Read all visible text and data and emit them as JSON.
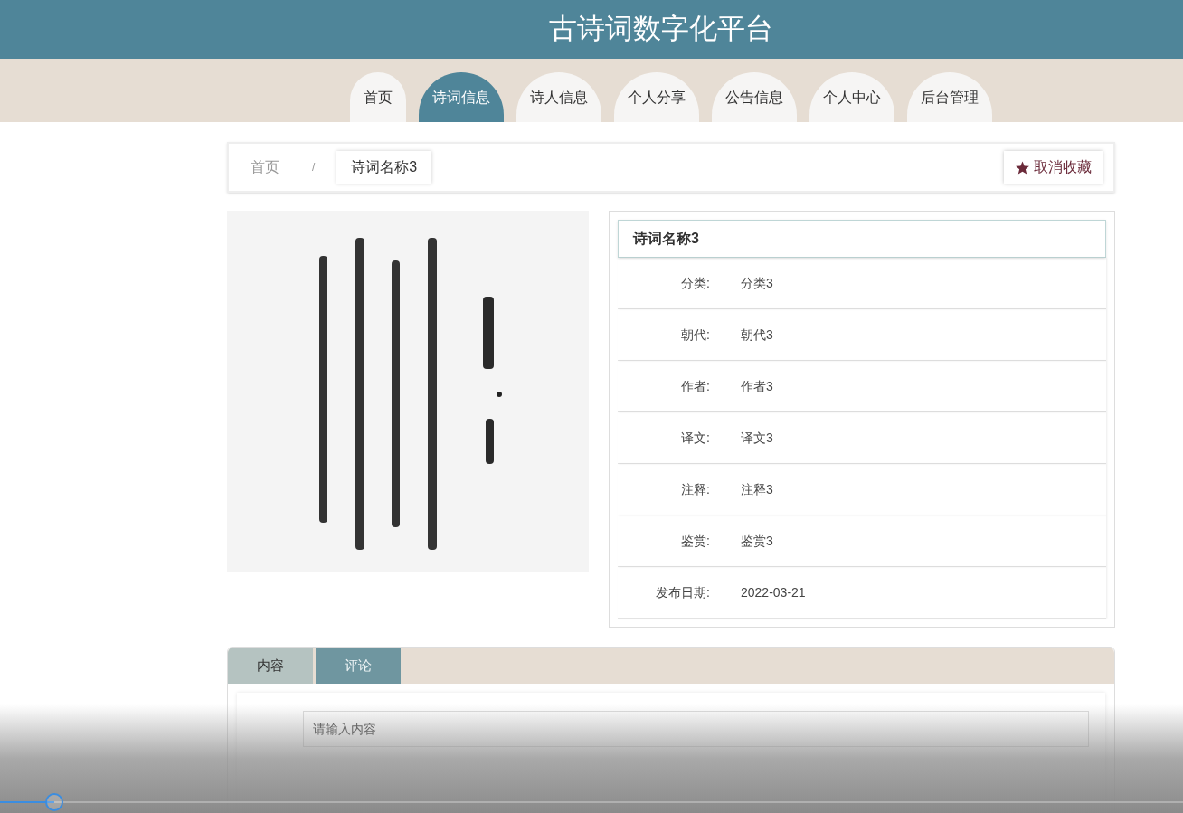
{
  "header": {
    "title": "古诗词数字化平台"
  },
  "nav": [
    {
      "label": "首页",
      "selected": false
    },
    {
      "label": "诗词信息",
      "selected": true
    },
    {
      "label": "诗人信息",
      "selected": false
    },
    {
      "label": "个人分享",
      "selected": false
    },
    {
      "label": "公告信息",
      "selected": false
    },
    {
      "label": "个人中心",
      "selected": false
    },
    {
      "label": "后台管理",
      "selected": false
    }
  ],
  "breadcrumb": {
    "items": [
      "首页",
      "诗词名称3"
    ],
    "separator": "/"
  },
  "favorite_button": {
    "label": "取消收藏"
  },
  "details": {
    "title": "诗词名称3",
    "rows": [
      {
        "label": "分类:",
        "value": "分类3"
      },
      {
        "label": "朝代:",
        "value": "朝代3"
      },
      {
        "label": "作者:",
        "value": "作者3"
      },
      {
        "label": "译文:",
        "value": "译文3"
      },
      {
        "label": "注释:",
        "value": "注释3"
      },
      {
        "label": "鉴赏:",
        "value": "鉴赏3"
      },
      {
        "label": "发布日期:",
        "value": "2022-03-21"
      }
    ]
  },
  "bottom_tabs": [
    {
      "label": "内容",
      "selected": false
    },
    {
      "label": "评论",
      "selected": true
    }
  ],
  "comment": {
    "placeholder": "请输入内容"
  },
  "video_player": {
    "level": 0.046
  }
}
